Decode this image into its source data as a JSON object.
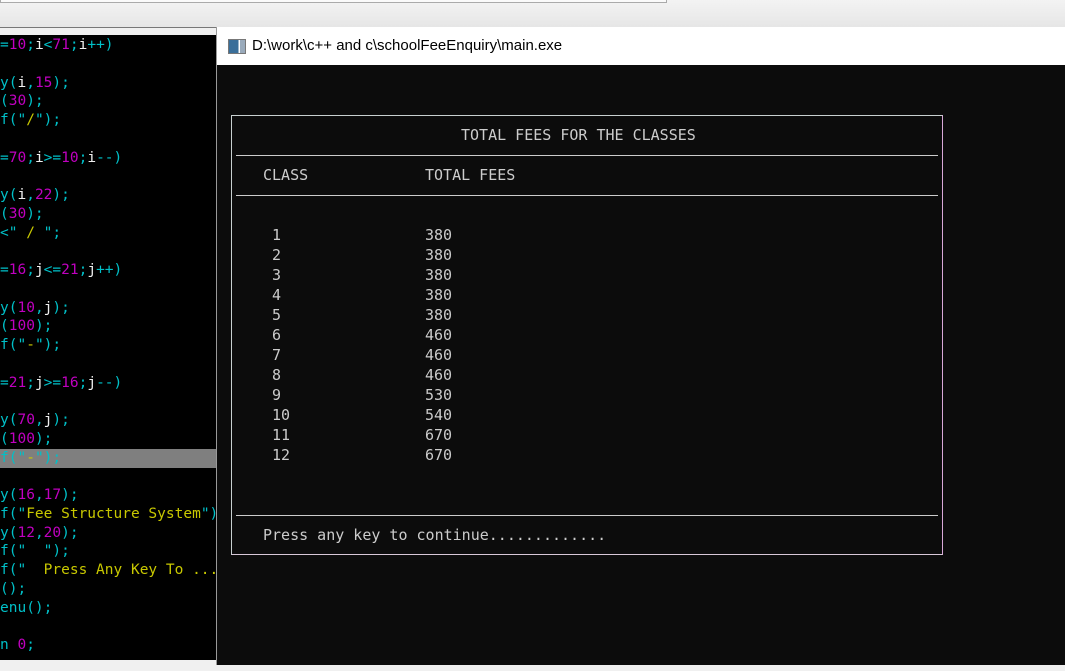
{
  "editor": {
    "lines": [
      {
        "row": 0,
        "text": "=10;i<71;i++)"
      },
      {
        "row": 2,
        "text": "y(i,15);"
      },
      {
        "row": 3,
        "text": "(30);"
      },
      {
        "row": 4,
        "text": "f(\"/\");"
      },
      {
        "row": 6,
        "text": "=70;i>=10;i--)"
      },
      {
        "row": 8,
        "text": "y(i,22);"
      },
      {
        "row": 9,
        "text": "(30);"
      },
      {
        "row": 10,
        "text": "<\" / \";"
      },
      {
        "row": 12,
        "text": "=16;j<=21;j++)"
      },
      {
        "row": 14,
        "text": "y(10,j);"
      },
      {
        "row": 15,
        "text": "(100);"
      },
      {
        "row": 16,
        "text": "f(\"-\");"
      },
      {
        "row": 18,
        "text": "=21;j>=16;j--)"
      },
      {
        "row": 20,
        "text": "y(70,j);"
      },
      {
        "row": 21,
        "text": "(100);"
      },
      {
        "row": 22,
        "text": "f(\"-\");",
        "highlighted": true
      },
      {
        "row": 24,
        "text": "y(16,17);"
      },
      {
        "row": 25,
        "text": "f(\"Fee Structure System\");"
      },
      {
        "row": 26,
        "text": "y(12,20);"
      },
      {
        "row": 27,
        "text": "f(\"  \");"
      },
      {
        "row": 28,
        "text": "f(\"  Press Any Key To ...\");"
      },
      {
        "row": 29,
        "text": "();"
      },
      {
        "row": 30,
        "text": "enu();"
      },
      {
        "row": 32,
        "text": "n 0;"
      }
    ],
    "colors": {
      "number": "#c000c0",
      "string": "#c8c800",
      "identifier": "#f0f0f0",
      "punctuation": "#00c0c8",
      "highlight": "#7f7f7f"
    }
  },
  "console": {
    "window_title": "D:\\work\\c++ and c\\schoolFeeEnquiry\\main.exe",
    "icon": "console-app-icon",
    "heading": "TOTAL FEES FOR THE CLASSES",
    "columns": [
      "CLASS",
      "TOTAL FEES"
    ],
    "rows": [
      {
        "class": "1",
        "fees": "380"
      },
      {
        "class": "2",
        "fees": "380"
      },
      {
        "class": "3",
        "fees": "380"
      },
      {
        "class": "4",
        "fees": "380"
      },
      {
        "class": "5",
        "fees": "380"
      },
      {
        "class": "6",
        "fees": "460"
      },
      {
        "class": "7",
        "fees": "460"
      },
      {
        "class": "8",
        "fees": "460"
      },
      {
        "class": "9",
        "fees": "530"
      },
      {
        "class": "10",
        "fees": "540"
      },
      {
        "class": "11",
        "fees": "670"
      },
      {
        "class": "12",
        "fees": "670"
      }
    ],
    "prompt": "Press any key to continue............."
  }
}
